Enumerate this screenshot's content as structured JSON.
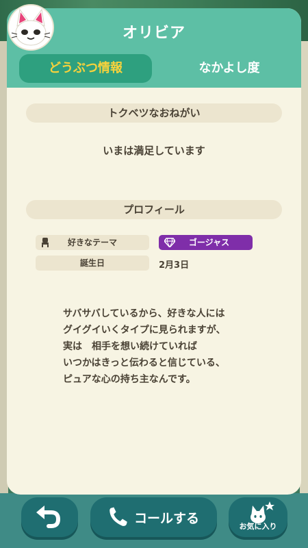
{
  "window": {
    "title": "オリビア"
  },
  "tabs": [
    {
      "label": "どうぶつ情報",
      "active": true
    },
    {
      "label": "なかよし度",
      "active": false
    }
  ],
  "special_request": {
    "heading": "トクベツなおねがい",
    "text": "いまは満足しています"
  },
  "profile": {
    "heading": "プロフィール",
    "favorite_theme_label": "好きなテーマ",
    "favorite_theme_value": "ゴージャス",
    "birthday_label": "誕生日",
    "birthday_value": "2月3日",
    "description_lines": [
      "サバサバしているから、好きな人には",
      "グイグイいくタイプに見られますが、",
      "実は　相手を想い続けていれば",
      "いつかはきっと伝わると信じている、",
      "ピュアな心の持ち主なんです。"
    ]
  },
  "buttons": {
    "back_icon": "back-arrow-icon",
    "call_label": "コールする",
    "call_icon": "phone-icon",
    "favorite_label": "お気に入り",
    "favorite_icon": "cat-star-icon"
  },
  "colors": {
    "header": "#5dbfa5",
    "tab_active_bg": "#2ea07f",
    "tab_active_text": "#f7d23c",
    "panel_bg": "#f7f4e3",
    "theme_badge": "#7f2ea9",
    "button_bg": "#1f6e71"
  }
}
